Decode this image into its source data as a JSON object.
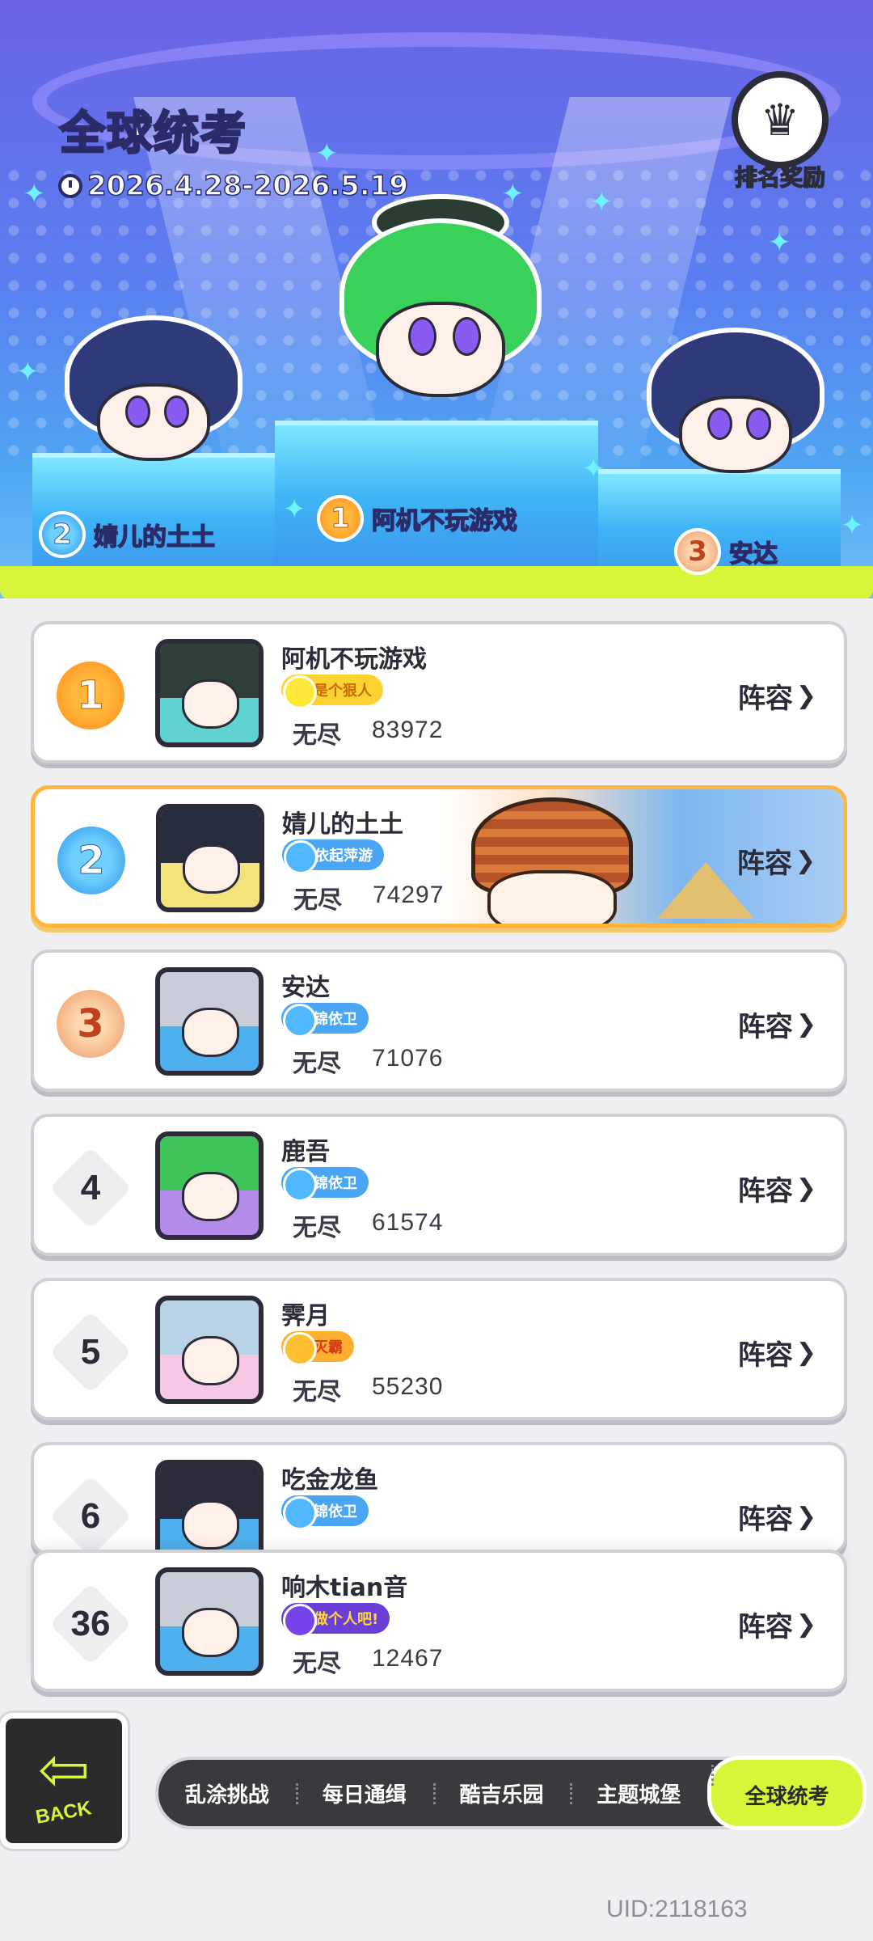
{
  "header": {
    "title": "全球统考",
    "date_range": "2026.4.28-2026.5.19",
    "reward_label": "排名奖励",
    "reward_icon": "trophy-shield-icon"
  },
  "podium": {
    "first": {
      "rank": "1",
      "name": "阿机不玩游戏"
    },
    "second": {
      "rank": "2",
      "name": "婧儿的土土"
    },
    "third": {
      "rank": "3",
      "name": "安达"
    }
  },
  "leaderboard": {
    "lineup_label": "阵容",
    "rows": [
      {
        "rank": "1",
        "name": "阿机不玩游戏",
        "badge": "是个狠人",
        "mode": "无尽",
        "score": "83972"
      },
      {
        "rank": "2",
        "name": "婧儿的土土",
        "badge": "依起萍游",
        "mode": "无尽",
        "score": "74297"
      },
      {
        "rank": "3",
        "name": "安达",
        "badge": "锦依卫",
        "mode": "无尽",
        "score": "71076"
      },
      {
        "rank": "4",
        "name": "鹿吾",
        "badge": "锦依卫",
        "mode": "无尽",
        "score": "61574"
      },
      {
        "rank": "5",
        "name": "霁月",
        "badge": "灭霸",
        "mode": "无尽",
        "score": "55230"
      },
      {
        "rank": "6",
        "name": "吃金龙鱼",
        "badge": "锦依卫"
      },
      {
        "rank": "36",
        "name": "响木tian音",
        "badge": "做个人吧!",
        "mode": "无尽",
        "score": "12467"
      }
    ]
  },
  "nav": {
    "back_label": "BACK",
    "tabs": [
      "乱涂挑战",
      "每日通缉",
      "酷吉乐园",
      "主题城堡",
      "全球统考"
    ],
    "active_tab": "全球统考"
  },
  "uid": "UID:2118163",
  "colors": {
    "accent_lime": "#d8f53a",
    "highlight_orange": "#ffb53b",
    "stage_purple": "#6a63e6",
    "stage_blue": "#4fa6f2"
  }
}
